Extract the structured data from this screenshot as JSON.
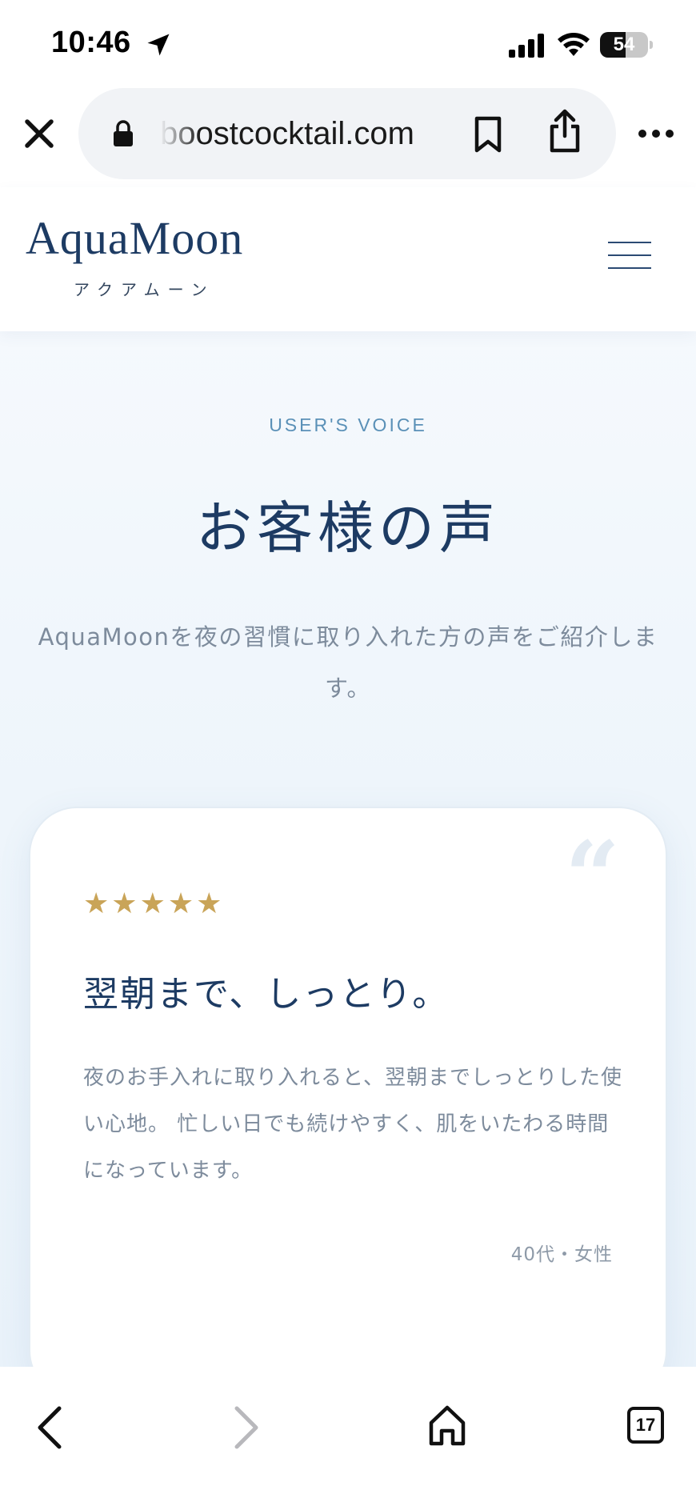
{
  "status_bar": {
    "time": "10:46",
    "battery_level": "54",
    "battery_fraction": 0.54
  },
  "browser": {
    "url": "boostcocktail.com",
    "tab_count": "17"
  },
  "header": {
    "logo": "AquaMoon",
    "logo_kana": "アクアムーン"
  },
  "section": {
    "eyebrow": "USER'S VOICE",
    "title": "お客様の声",
    "description": "AquaMoonを夜の習慣に取り入れた方の声をご紹介します。"
  },
  "testimonial": {
    "rating": 5,
    "quote_mark": "“",
    "title": "翌朝まで、しっとり。",
    "body": "夜のお手入れに取り入れると、翌朝までしっとりした使い心地。 忙しい日でも続けやすく、肌をいたわる時間になっています。",
    "author": "40代・女性"
  },
  "colors": {
    "navy": "#1d3b63",
    "accent_blue": "#5a90b7",
    "gold_star": "#c9a458",
    "muted_text": "#7d8b9c"
  },
  "icons": {
    "close": "close-icon",
    "lock": "lock-icon",
    "bookmark": "bookmark-icon",
    "share": "share-icon",
    "more": "more-icon",
    "menu": "hamburger-icon",
    "back": "chevron-left-icon",
    "forward": "chevron-right-icon",
    "home": "home-icon",
    "tabs": "tabs-icon"
  }
}
